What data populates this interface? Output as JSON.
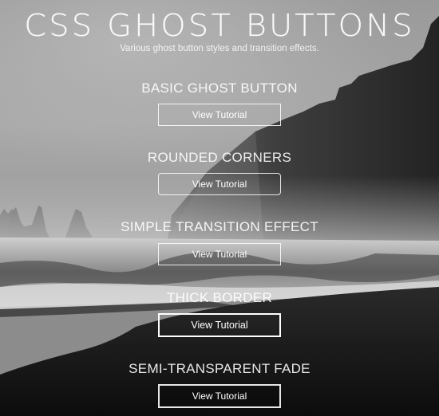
{
  "page": {
    "title": "CSS GHOST BUTTONS",
    "subtitle": "Various ghost button styles and transition effects."
  },
  "sections": [
    {
      "heading": "BASIC GHOST BUTTON",
      "button_label": "View Tutorial",
      "style": "basic"
    },
    {
      "heading": "ROUNDED CORNERS",
      "button_label": "View Tutorial",
      "style": "rounded"
    },
    {
      "heading": "SIMPLE TRANSITION EFFECT",
      "button_label": "View Tutorial",
      "style": "transition"
    },
    {
      "heading": "THICK BORDER",
      "button_label": "View Tutorial",
      "style": "thick"
    },
    {
      "heading": "SEMI-TRANSPARENT FADE",
      "button_label": "View Tutorial",
      "style": "fade"
    }
  ],
  "background": {
    "description": "black and white photo of sea stacks, cliffs and waves on a black sand beach"
  }
}
